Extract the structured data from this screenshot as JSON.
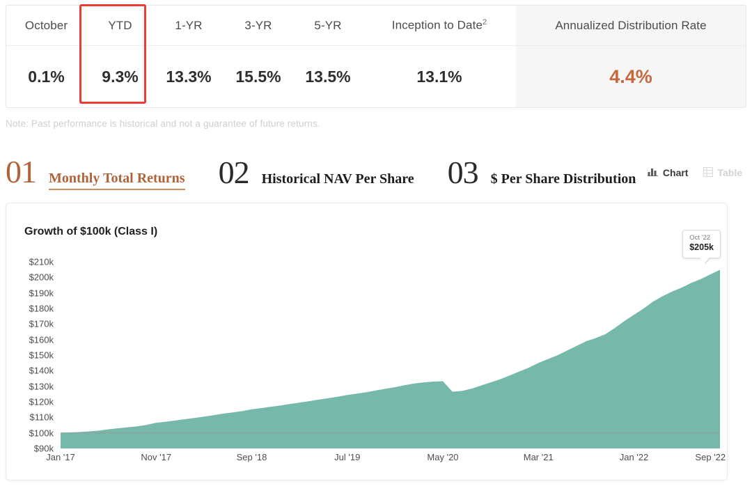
{
  "performance_table": {
    "columns": [
      {
        "key": "october",
        "label": "October",
        "sup": "",
        "shaded": false
      },
      {
        "key": "ytd",
        "label": "YTD",
        "sup": "",
        "shaded": false
      },
      {
        "key": "yr1",
        "label": "1-YR",
        "sup": "",
        "shaded": false
      },
      {
        "key": "yr3",
        "label": "3-YR",
        "sup": "",
        "shaded": false
      },
      {
        "key": "yr5",
        "label": "5-YR",
        "sup": "",
        "shaded": false
      },
      {
        "key": "itd",
        "label": "Inception to Date",
        "sup": "2",
        "shaded": false
      },
      {
        "key": "adr",
        "label": "Annualized Distribution Rate",
        "sup": "",
        "shaded": true
      }
    ],
    "values": {
      "october": "0.1%",
      "ytd": "9.3%",
      "yr1": "13.3%",
      "yr3": "15.5%",
      "yr5": "13.5%",
      "itd": "13.1%",
      "adr": "4.4%"
    },
    "highlight_column": "ytd",
    "highlight_color": "#ec3a35",
    "accent_color": "#c4693f"
  },
  "note": "Note: Past performance is historical and not a guarantee of future returns.",
  "tabs": [
    {
      "number": "01",
      "label": "Monthly Total Returns",
      "active": true
    },
    {
      "number": "02",
      "label": "Historical NAV Per Share",
      "active": false
    },
    {
      "number": "03",
      "label": "$ Per Share Distribution",
      "active": false
    }
  ],
  "view_toggle": [
    {
      "key": "chart",
      "label": "Chart",
      "icon": "bar-chart-icon",
      "selected": true
    },
    {
      "key": "table",
      "label": "Table",
      "icon": "table-grid-icon",
      "selected": false
    }
  ],
  "chart_card": {
    "title": "Growth of $100k (Class I)",
    "tooltip": {
      "date": "Oct '22",
      "value": "$205k"
    }
  },
  "chart_data": {
    "type": "area",
    "title": "Growth of $100k (Class I)",
    "xlabel": "",
    "ylabel": "",
    "ylim": [
      90000,
      215000
    ],
    "y_ticks": [
      210000,
      200000,
      190000,
      180000,
      170000,
      160000,
      150000,
      140000,
      130000,
      120000,
      110000,
      100000,
      90000
    ],
    "y_tick_labels": [
      "$210k",
      "$200k",
      "$190k",
      "$180k",
      "$170k",
      "$160k",
      "$150k",
      "$140k",
      "$130k",
      "$120k",
      "$110k",
      "$100k",
      "$90k"
    ],
    "x_tick_labels": [
      "Jan '17",
      "Nov '17",
      "Sep '18",
      "Jul '19",
      "May '20",
      "Mar '21",
      "Jan '22",
      "Sep '22"
    ],
    "x_tick_indices": [
      0,
      10,
      20,
      30,
      40,
      50,
      60,
      68
    ],
    "x_range_start": "Jan '17",
    "x_range_end": "Oct '22",
    "grid": "single-horizontal-at-100k",
    "legend": "none",
    "series": [
      {
        "name": "Growth of $100k (Class I)",
        "fill_color": "#76b8a9",
        "x": [
          "Jan '17",
          "Feb '17",
          "Mar '17",
          "Apr '17",
          "May '17",
          "Jun '17",
          "Jul '17",
          "Aug '17",
          "Sep '17",
          "Oct '17",
          "Nov '17",
          "Dec '17",
          "Jan '18",
          "Feb '18",
          "Mar '18",
          "Apr '18",
          "May '18",
          "Jun '18",
          "Jul '18",
          "Aug '18",
          "Sep '18",
          "Oct '18",
          "Nov '18",
          "Dec '18",
          "Jan '19",
          "Feb '19",
          "Mar '19",
          "Apr '19",
          "May '19",
          "Jun '19",
          "Jul '19",
          "Aug '19",
          "Sep '19",
          "Oct '19",
          "Nov '19",
          "Dec '19",
          "Jan '20",
          "Feb '20",
          "Mar '20",
          "Apr '20",
          "May '20",
          "Jun '20",
          "Jul '20",
          "Aug '20",
          "Sep '20",
          "Oct '20",
          "Nov '20",
          "Dec '20",
          "Jan '21",
          "Feb '21",
          "Mar '21",
          "Apr '21",
          "May '21",
          "Jun '21",
          "Jul '21",
          "Aug '21",
          "Sep '21",
          "Oct '21",
          "Nov '21",
          "Dec '21",
          "Jan '22",
          "Feb '22",
          "Mar '22",
          "Apr '22",
          "May '22",
          "Jun '22",
          "Jul '22",
          "Aug '22",
          "Sep '22",
          "Oct '22"
        ],
        "values": [
          100000,
          100300,
          100600,
          101000,
          101500,
          102300,
          103000,
          103600,
          104200,
          105200,
          106500,
          107200,
          108000,
          108800,
          109600,
          110500,
          111400,
          112400,
          113200,
          114000,
          115200,
          116000,
          116800,
          117600,
          118600,
          119500,
          120400,
          121400,
          122300,
          123300,
          124400,
          125300,
          126200,
          127300,
          128400,
          129400,
          130700,
          131800,
          132500,
          133000,
          133300,
          126500,
          127000,
          128500,
          130500,
          132500,
          134500,
          137000,
          139500,
          142000,
          145000,
          147500,
          150000,
          153000,
          156000,
          159000,
          161000,
          163500,
          167500,
          172000,
          176000,
          180000,
          184500,
          188000,
          191000,
          193500,
          196500,
          199000,
          202000,
          205000
        ]
      }
    ],
    "annotations": [
      {
        "label": "Oct '22",
        "value": "$205k",
        "type": "tooltip"
      }
    ]
  }
}
